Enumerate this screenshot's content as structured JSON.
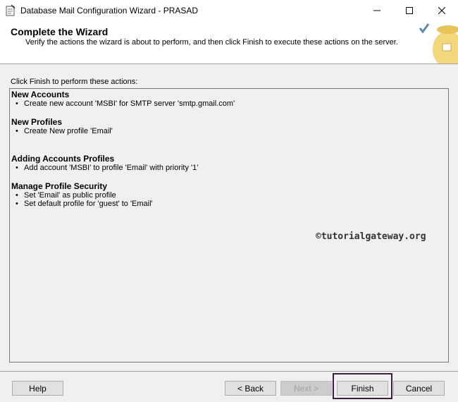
{
  "window": {
    "title": "Database Mail Configuration Wizard - PRASAD",
    "icons": {
      "minimize": "minimize-icon",
      "maximize": "maximize-icon",
      "close": "close-icon"
    }
  },
  "header": {
    "title": "Complete the Wizard",
    "subtitle": "Verify the actions the wizard is about to perform, and then click Finish to execute these actions on the server."
  },
  "prompt": "Click Finish to perform these actions:",
  "sections": [
    {
      "heading": "New Accounts",
      "items": [
        "Create new account 'MSBI' for SMTP server 'smtp.gmail.com'"
      ]
    },
    {
      "heading": "New Profiles",
      "items": [
        "Create New profile 'Email'"
      ]
    },
    {
      "heading": "Adding Accounts Profiles",
      "items": [
        "Add account 'MSBI' to profile 'Email' with priority '1'"
      ]
    },
    {
      "heading": "Manage Profile Security",
      "items": [
        "Set 'Email' as public profile",
        "Set default profile for 'guest' to 'Email'"
      ]
    }
  ],
  "bullet": "•",
  "watermark": "©tutorialgateway.org",
  "buttons": {
    "help": "Help",
    "back": "< Back",
    "next": "Next >",
    "finish": "Finish",
    "cancel": "Cancel"
  },
  "colors": {
    "highlight_border": "#3d1f3f",
    "title_bar": "#ffffff",
    "dialog_bg": "#f0f0f0"
  }
}
